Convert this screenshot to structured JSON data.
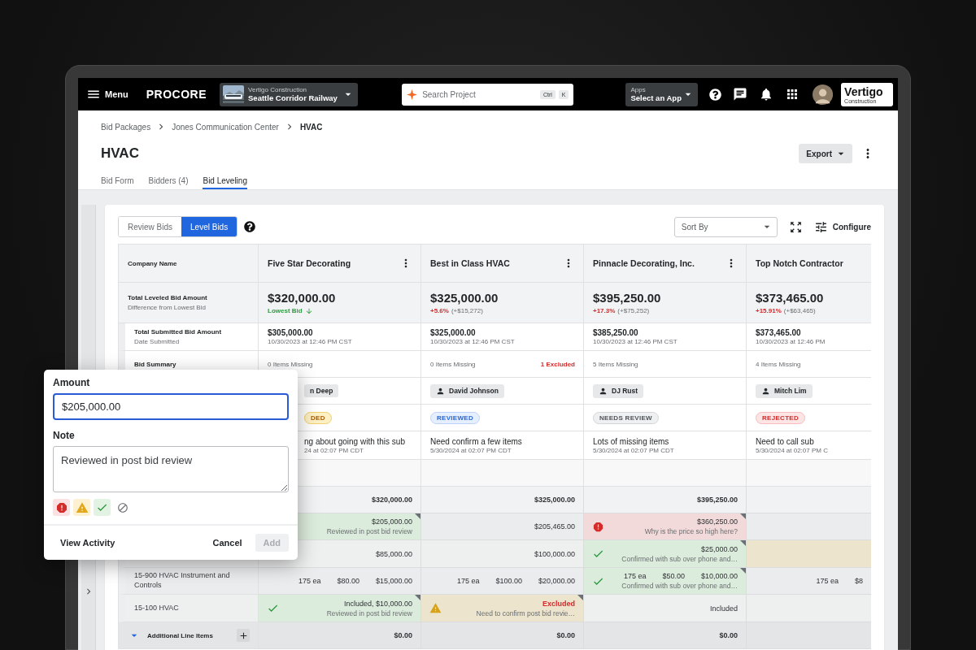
{
  "nav": {
    "menu_label": "Menu",
    "logo": "PROCORE",
    "project": {
      "company": "Vertigo Construction",
      "name": "Seattle Corridor Railway"
    },
    "search": {
      "placeholder": "Search Project",
      "shortcut": [
        "Ctrl",
        "K"
      ]
    },
    "apps": {
      "label": "Apps",
      "value": "Select an App"
    },
    "brand": {
      "name": "Vertigo",
      "tagline": "Construction"
    }
  },
  "breadcrumbs": [
    {
      "label": "Bid Packages",
      "current": false
    },
    {
      "label": "Jones Communication Center",
      "current": false
    },
    {
      "label": "HVAC",
      "current": true
    }
  ],
  "title": "HVAC",
  "export_button": "Export",
  "tabs": [
    {
      "label": "Bid Form",
      "selected": false
    },
    {
      "label": "Bidders (4)",
      "selected": false
    },
    {
      "label": "Bid Leveling",
      "selected": true
    }
  ],
  "view_toggle": [
    {
      "label": "Review Bids",
      "selected": false
    },
    {
      "label": "Level Bids",
      "selected": true
    }
  ],
  "sort": {
    "placeholder": "Sort By"
  },
  "configure_button": "Configure",
  "table": {
    "row_labels": {
      "company": "Company Name",
      "leveled": "Total Leveled Bid Amount",
      "leveled_sub": "Difference from Lowest Bid",
      "submitted": "Total Submitted Bid Amount",
      "submitted_sub": "Date Submitted",
      "summary": "Bid Summary"
    },
    "bidders": [
      {
        "name": "Five Star Decorating",
        "menu": true,
        "leveled": "$320,000.00",
        "diff": {
          "kind": "lowest",
          "text": "Lowest Bid"
        },
        "submitted": "$305,000.00",
        "date": "10/30/2023 at 12:46 PM CST",
        "missing": "0 Items Missing",
        "contact": "n Deep",
        "status": {
          "label": "DED",
          "kind": "pending"
        },
        "note": "ng about going with this sub",
        "note_date": "24 at 02:07 PM CDT"
      },
      {
        "name": "Best in Class HVAC",
        "menu": true,
        "leveled": "$325,000.00",
        "diff": {
          "kind": "higher",
          "pct": "+5.6%",
          "amount": "(+$15,272)"
        },
        "submitted": "$325,000.00",
        "date": "10/30/2023 at 12:46 PM CST",
        "missing": "0 Items Missing",
        "excluded": "1 Excluded",
        "contact": "David Johnson",
        "status": {
          "label": "REVIEWED",
          "kind": "reviewed"
        },
        "note": "Need confirm a few items",
        "note_date": "5/30/2024 at 02:07 PM CDT"
      },
      {
        "name": "Pinnacle Decorating, Inc.",
        "menu": true,
        "leveled": "$395,250.00",
        "diff": {
          "kind": "higher",
          "pct": "+17.3%",
          "amount": "(+$75,252)"
        },
        "submitted": "$385,250.00",
        "date": "10/30/2023 at 12:46 PM CST",
        "missing": "5 Items Missing",
        "contact": "DJ Rust",
        "status": {
          "label": "NEEDS REVIEW",
          "kind": "needs_review"
        },
        "note": "Lots of missing items",
        "note_date": "5/30/2024 at 02:07 PM CDT"
      },
      {
        "name": "Top Notch Contractor",
        "menu": false,
        "leveled": "$373,465.00",
        "diff": {
          "kind": "higher",
          "pct": "+15.91%",
          "amount": "(+$63,465)"
        },
        "submitted": "$373,465.00",
        "date": "10/30/2023 at 12:46 PM",
        "missing": "4 Items Missing",
        "contact": "Mitch Lim",
        "status": {
          "label": "REJECTED",
          "kind": "rejected"
        },
        "note": "Need to call sub",
        "note_date": "5/30/2024 at 02:07 PM C"
      }
    ],
    "line_rows": [
      {
        "kind": "blank"
      },
      {
        "kind": "total",
        "cells": [
          {
            "values": [
              "$320,000.00"
            ]
          },
          {
            "values": [
              "$325,000.00"
            ]
          },
          {
            "values": [
              "$395,250.00"
            ]
          },
          null
        ]
      },
      {
        "kind": "line",
        "cells": [
          {
            "kind": "reviewed",
            "values": [
              "$205,000.00"
            ],
            "note": "Reviewed in post bid review",
            "flagged": true
          },
          {
            "values": [
              "$205,465.00"
            ]
          },
          {
            "kind": "issue",
            "values": [
              "$360,250.00"
            ],
            "note": "Why is the price so high here?",
            "flagged": true
          },
          null
        ]
      },
      {
        "kind": "line",
        "cells": [
          {
            "values": [
              "$85,000.00"
            ]
          },
          {
            "values": [
              "$100,000.00"
            ]
          },
          {
            "kind": "confirmed",
            "values": [
              "$25,000.00"
            ],
            "note": "Confirmed with sub over phone and…",
            "flagged": true
          },
          {
            "kind": "pending"
          }
        ]
      },
      {
        "kind": "line",
        "label": "15-900 HVAC Instrument and Controls",
        "cells": [
          {
            "values": [
              "175 ea",
              "$80.00",
              "$15,000.00"
            ]
          },
          {
            "values": [
              "175 ea",
              "$100.00",
              "$20,000.00"
            ]
          },
          {
            "kind": "confirmed",
            "values": [
              "175 ea",
              "$50.00",
              "$10,000.00"
            ],
            "note": "Confirmed with sub over phone and…",
            "flagged": true
          },
          {
            "values": [
              "175 ea",
              "$8"
            ]
          }
        ]
      },
      {
        "kind": "line",
        "label": "15-100 HVAC",
        "cells": [
          {
            "kind": "confirmed",
            "values": [
              "Included, $10,000.00"
            ],
            "note": "Reviewed in post bid review",
            "flagged": true
          },
          {
            "kind": "attention",
            "values": [
              "Excluded"
            ],
            "excluded": true,
            "note": "Need to confirm post bid revie…",
            "flagged": true
          },
          {
            "values": [
              "Included"
            ]
          },
          null
        ]
      },
      {
        "kind": "section",
        "label": "Additional Line Items",
        "cells": [
          {
            "values": [
              "$0.00"
            ]
          },
          {
            "values": [
              "$0.00"
            ]
          },
          {
            "values": [
              "$0.00"
            ]
          },
          null
        ]
      }
    ]
  },
  "popover": {
    "amount_label": "Amount",
    "amount_value": "$205,000.00",
    "note_label": "Note",
    "note_value": "Reviewed in post bid review",
    "view_activity": "View Activity",
    "cancel": "Cancel",
    "add": "Add",
    "add_disabled": true
  }
}
